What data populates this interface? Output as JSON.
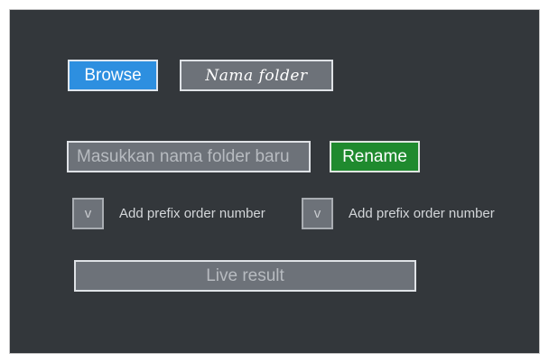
{
  "toolbar": {
    "browse_label": "Browse",
    "folder_name": "Nama folder"
  },
  "rename": {
    "input_value": "",
    "input_placeholder": "Masukkan nama folder baru",
    "button_label": "Rename"
  },
  "options": [
    {
      "checkbox_mark": "v",
      "label": "Add prefix order number"
    },
    {
      "checkbox_mark": "v",
      "label": "Add prefix order number"
    }
  ],
  "result": {
    "text": "Live result"
  },
  "colors": {
    "panel_bg": "#33373b",
    "browse_bg": "#2d8fe0",
    "rename_bg": "#1f8a2e",
    "field_bg": "#6d7279"
  },
  "icons": {
    "checkbox_mark": "check-v-glyph"
  }
}
